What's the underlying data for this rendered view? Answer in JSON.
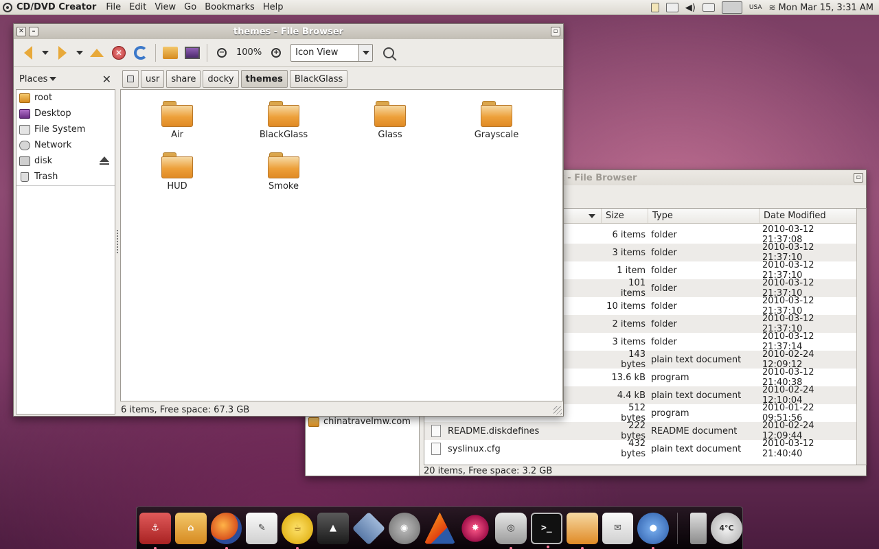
{
  "top_panel": {
    "app_name": "CD/DVD Creator",
    "menus": [
      "File",
      "Edit",
      "View",
      "Go",
      "Bookmarks",
      "Help"
    ],
    "keyboard_layout": "USA",
    "clock": "Mon Mar 15,  3:31 AM"
  },
  "front_window": {
    "title": "themes - File Browser",
    "zoom": "100%",
    "view_mode": "Icon View",
    "places_label": "Places",
    "breadcrumbs": [
      "usr",
      "share",
      "docky",
      "themes",
      "BlackGlass"
    ],
    "places": [
      {
        "label": "root",
        "icon": "home-folder-icon"
      },
      {
        "label": "Desktop",
        "icon": "desktop-icon"
      },
      {
        "label": "File System",
        "icon": "filesystem-icon"
      },
      {
        "label": "Network",
        "icon": "network-icon"
      },
      {
        "label": "disk",
        "icon": "disk-icon"
      },
      {
        "label": "Trash",
        "icon": "trash-icon"
      }
    ],
    "folders": [
      "Air",
      "BlackGlass",
      "Glass",
      "Grayscale",
      "HUD",
      "Smoke"
    ],
    "status": "6 items, Free space: 67.3 GB"
  },
  "back_window": {
    "title_fragment": "k - File Browser",
    "columns": {
      "size": "Size",
      "type": "Type",
      "date": "Date Modified"
    },
    "rows": [
      {
        "name": "",
        "size": "6 items",
        "type": "folder",
        "date": "2010-03-12 21:37:08"
      },
      {
        "name": "",
        "size": "3 items",
        "type": "folder",
        "date": "2010-03-12 21:37:10"
      },
      {
        "name": "",
        "size": "1 item",
        "type": "folder",
        "date": "2010-03-12 21:37:10"
      },
      {
        "name": "",
        "size": "101 items",
        "type": "folder",
        "date": "2010-03-12 21:37:10"
      },
      {
        "name": "",
        "size": "10 items",
        "type": "folder",
        "date": "2010-03-12 21:37:10"
      },
      {
        "name": "",
        "size": "2 items",
        "type": "folder",
        "date": "2010-03-12 21:37:10"
      },
      {
        "name": "",
        "size": "3 items",
        "type": "folder",
        "date": "2010-03-12 21:37:14"
      },
      {
        "name": "",
        "size": "143 bytes",
        "type": "plain text document",
        "date": "2010-02-24 12:09:12"
      },
      {
        "name": "",
        "size": "13.6 kB",
        "type": "program",
        "date": "2010-03-12 21:40:38"
      },
      {
        "name": "",
        "size": "4.4 kB",
        "type": "plain text document",
        "date": "2010-02-24 12:10:04"
      },
      {
        "name": "",
        "size": "512 bytes",
        "type": "program",
        "date": "2010-01-22 09:51:56"
      },
      {
        "name": "README.diskdefines",
        "size": "222 bytes",
        "type": "README document",
        "date": "2010-02-24 12:09:44"
      },
      {
        "name": "syslinux.cfg",
        "size": "432 bytes",
        "type": "plain text document",
        "date": "2010-03-12 21:40:40"
      }
    ],
    "sidebar_item": "chinatravelmw.com",
    "status": "20 items, Free space: 3.2 GB"
  },
  "dock": {
    "weather": "4°C"
  }
}
